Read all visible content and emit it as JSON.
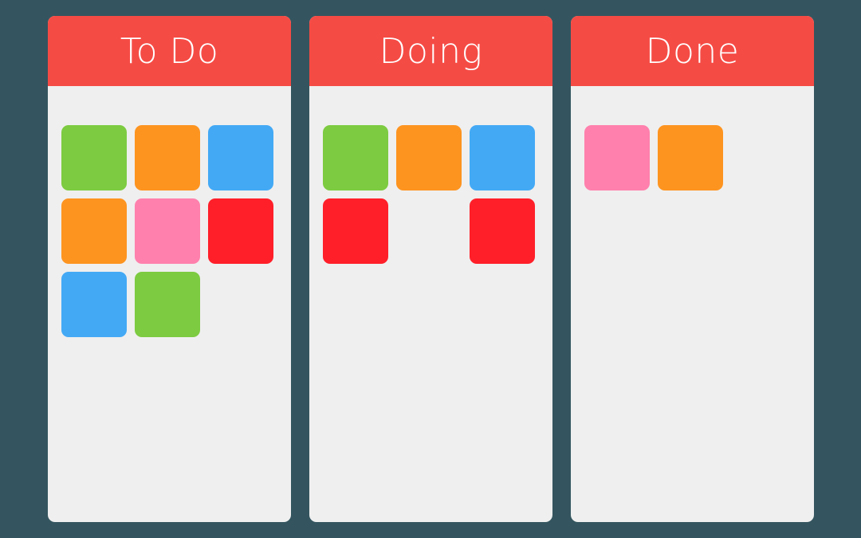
{
  "board": {
    "columns": [
      {
        "title": "To Do",
        "cards": [
          {
            "color": "green",
            "row": 0,
            "col": 0
          },
          {
            "color": "orange",
            "row": 0,
            "col": 1
          },
          {
            "color": "blue",
            "row": 0,
            "col": 2
          },
          {
            "color": "orange",
            "row": 1,
            "col": 0
          },
          {
            "color": "pink",
            "row": 1,
            "col": 1
          },
          {
            "color": "red",
            "row": 1,
            "col": 2
          },
          {
            "color": "blue",
            "row": 2,
            "col": 0
          },
          {
            "color": "green",
            "row": 2,
            "col": 1
          }
        ]
      },
      {
        "title": "Doing",
        "cards": [
          {
            "color": "green",
            "row": 0,
            "col": 0
          },
          {
            "color": "orange",
            "row": 0,
            "col": 1
          },
          {
            "color": "blue",
            "row": 0,
            "col": 2
          },
          {
            "color": "red",
            "row": 1,
            "col": 0
          },
          {
            "color": "red",
            "row": 1,
            "col": 2
          }
        ]
      },
      {
        "title": "Done",
        "cards": [
          {
            "color": "pink",
            "row": 0,
            "col": 0
          },
          {
            "color": "orange",
            "row": 0,
            "col": 1
          }
        ]
      }
    ]
  },
  "colors": {
    "header": "#f54b45",
    "green": "#7dcb41",
    "orange": "#fd9420",
    "blue": "#43a9f5",
    "pink": "#ff80ac",
    "red": "#ff1f29"
  }
}
